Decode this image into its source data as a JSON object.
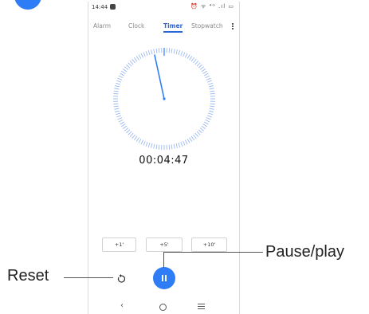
{
  "status_bar": {
    "time": "14:44",
    "icons": "⏰ ᯤ ⁴ᴳ .ıl ▭"
  },
  "tabs": [
    {
      "label": "Alarm",
      "active": false
    },
    {
      "label": "Clock",
      "active": false
    },
    {
      "label": "Timer",
      "active": true
    },
    {
      "label": "Stopwatch",
      "active": false
    }
  ],
  "timer": {
    "remaining": "00:04:47"
  },
  "quick_add": [
    {
      "label": "+1'"
    },
    {
      "label": "+5'"
    },
    {
      "label": "+10'"
    }
  ],
  "callouts": {
    "reset": "Reset",
    "pause_play": "Pause/play"
  },
  "colors": {
    "accent": "#2f7df6",
    "tick": "#8fb0ee",
    "tab_active": "#2b63d9"
  },
  "icons": {
    "overflow": "more-vert-icon",
    "reset": "reset-icon",
    "pause": "pause-icon",
    "nav_back": "back-icon",
    "nav_home": "home-icon",
    "nav_recent": "recents-icon"
  }
}
